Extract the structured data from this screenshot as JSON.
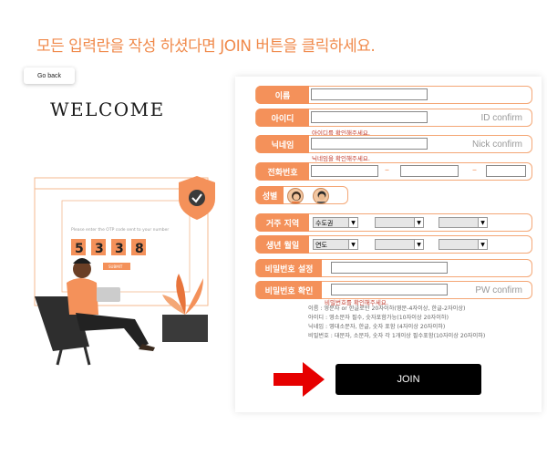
{
  "instruction": "모든 입력란을 작성 하셨다면 JOIN 버튼을 클릭하세요.",
  "back_button": "Go back",
  "welcome": "WELCOME",
  "illustration": {
    "otp_text": "Please enter the OTP code sent to your number",
    "otp_digits": [
      "5",
      "3",
      "3",
      "8"
    ],
    "submit_label": "SUBMIT"
  },
  "form": {
    "name": {
      "label": "이름",
      "value": ""
    },
    "id": {
      "label": "아이디",
      "value": "",
      "confirm": "ID confirm",
      "hint": "아이디를 확인해주세요."
    },
    "nickname": {
      "label": "닉네임",
      "value": "",
      "confirm": "Nick confirm",
      "hint": "닉네임을 확인해주세요."
    },
    "phone": {
      "label": "전화번호",
      "parts": [
        "",
        "",
        ""
      ],
      "separator": "–"
    },
    "gender": {
      "label": "성별",
      "options": [
        "female-avatar",
        "male-avatar"
      ]
    },
    "region": {
      "label": "거주 지역",
      "selects": [
        "수도권",
        "",
        ""
      ]
    },
    "birth": {
      "label": "생년 월일",
      "selects": [
        "연도",
        "",
        ""
      ]
    },
    "password": {
      "label": "비밀번호 설정",
      "value": ""
    },
    "password_confirm": {
      "label": "비밀번호 확인",
      "value": "",
      "confirm": "PW confirm",
      "hint": "비밀번호를 확인해주세요."
    },
    "notes": [
      "이름 : 영문자 or 한글로만 20자이하(영문-4자이상, 한글-2자이상)",
      "아이디 : 영소문자 필수, 숫자포함가능(10자이상 20자이하)",
      "닉네임 : 영대소문자, 한글, 숫자 포함 (4자이상 20자이하)",
      "비밀번호 : 대문자, 소문자, 숫자 각 1개이상 필수포함(10자이상 20자이하)"
    ],
    "join_label": "JOIN"
  },
  "colors": {
    "accent": "#f4915a",
    "instruction": "#f08a4b",
    "border": "#f4a776",
    "arrow": "#e60000"
  }
}
